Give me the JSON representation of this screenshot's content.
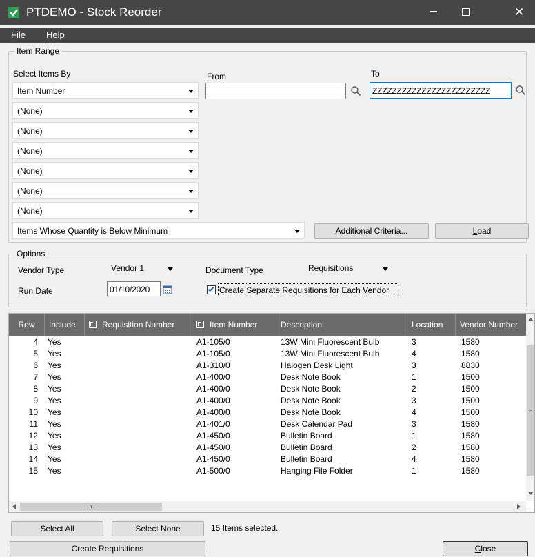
{
  "window": {
    "title": "PTDEMO - Stock Reorder",
    "minimize_label": "minimize",
    "maximize_label": "maximize",
    "close_glyph": "✕"
  },
  "menu": [
    {
      "label": "F",
      "rest": "ile"
    },
    {
      "label": "H",
      "rest": "elp"
    }
  ],
  "item_range": {
    "legend": "Item Range",
    "select_items_by_label": "Select Items By",
    "from_label": "From",
    "to_label": "To",
    "selectors": [
      "Item Number",
      "(None)",
      "(None)",
      "(None)",
      "(None)",
      "(None)",
      "(None)"
    ],
    "from_value": "",
    "to_value": "ZZZZZZZZZZZZZZZZZZZZZZZZ",
    "criteria_value": "Items Whose Quantity is Below Minimum",
    "additional_criteria_label": "Additional Criteria...",
    "load_label_u": "L",
    "load_label_rest": "oad"
  },
  "options": {
    "legend": "Options",
    "vendor_type_label": "Vendor Type",
    "vendor_type_value": "Vendor 1",
    "document_type_label": "Document Type",
    "document_type_value": "Requisitions",
    "run_date_label": "Run Date",
    "run_date_value": "01/10/2020",
    "separate_requisitions_label": "Create Separate Requisitions for Each Vendor",
    "separate_requisitions_checked": true
  },
  "grid": {
    "columns": [
      "Row",
      "Include",
      "Requisition Number",
      "Item Number",
      "Description",
      "Location",
      "Vendor Number"
    ],
    "rows": [
      [
        "4",
        "Yes",
        "",
        "A1-105/0",
        "13W Mini Fluorescent Bulb",
        "3",
        "1580"
      ],
      [
        "5",
        "Yes",
        "",
        "A1-105/0",
        "13W Mini Fluorescent Bulb",
        "4",
        "1580"
      ],
      [
        "6",
        "Yes",
        "",
        "A1-310/0",
        "Halogen Desk Light",
        "3",
        "8830"
      ],
      [
        "7",
        "Yes",
        "",
        "A1-400/0",
        "Desk Note Book",
        "1",
        "1500"
      ],
      [
        "8",
        "Yes",
        "",
        "A1-400/0",
        "Desk Note Book",
        "2",
        "1500"
      ],
      [
        "9",
        "Yes",
        "",
        "A1-400/0",
        "Desk Note Book",
        "3",
        "1500"
      ],
      [
        "10",
        "Yes",
        "",
        "A1-400/0",
        "Desk Note Book",
        "4",
        "1500"
      ],
      [
        "11",
        "Yes",
        "",
        "A1-401/0",
        "Desk Calendar Pad",
        "3",
        "1580"
      ],
      [
        "12",
        "Yes",
        "",
        "A1-450/0",
        "Bulletin Board",
        "1",
        "1580"
      ],
      [
        "13",
        "Yes",
        "",
        "A1-450/0",
        "Bulletin Board",
        "2",
        "1580"
      ],
      [
        "14",
        "Yes",
        "",
        "A1-450/0",
        "Bulletin Board",
        "4",
        "1580"
      ],
      [
        "15",
        "Yes",
        "",
        "A1-500/0",
        "Hanging File Folder",
        "1",
        "1580"
      ]
    ]
  },
  "footer": {
    "select_all_label": "Select All",
    "select_none_label": "Select None",
    "status_text": "15 Items selected.",
    "create_requisitions_label": "Create Requisitions",
    "close_label_u": "C",
    "close_label_rest": "lose"
  },
  "colors": {
    "titlebar": "#464646",
    "grid_header": "#6b6b6b",
    "accent": "#0078d7",
    "app_icon": "#2e9e4f"
  },
  "icons": {
    "app": "green-check-icon",
    "search": "magnifier-icon",
    "calendar": "calendar-icon",
    "column_lookup": "lookup-icon"
  }
}
